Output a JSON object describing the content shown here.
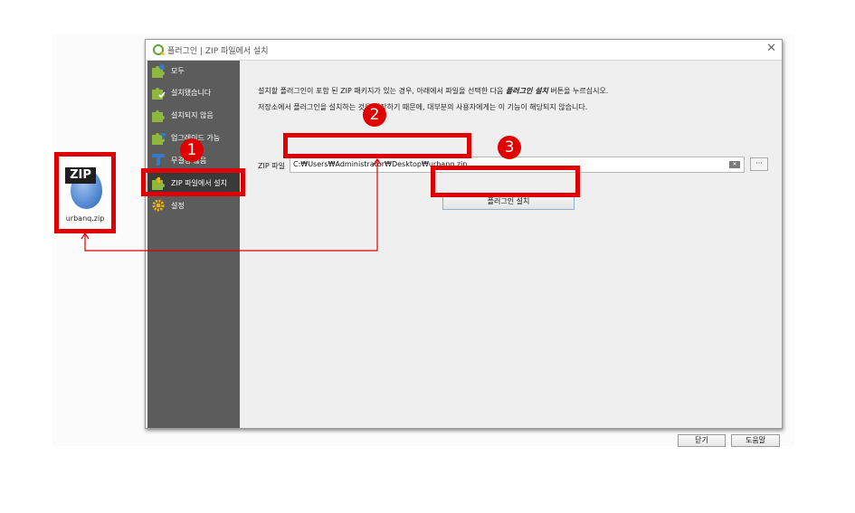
{
  "desktop_file": {
    "name": "urbanq.zip",
    "tag": "ZIP"
  },
  "window": {
    "title": "플러그인 | ZIP 파일에서 설치",
    "close_glyph": "✕"
  },
  "sidebar": {
    "items": [
      {
        "label": "모두",
        "icon": "puzzle-icon"
      },
      {
        "label": "설치됐습니다",
        "icon": "puzzle-installed-icon"
      },
      {
        "label": "설치되지 않음",
        "icon": "puzzle-not-installed-icon"
      },
      {
        "label": "업그레이드 가능",
        "icon": "puzzle-upgradeable-icon"
      },
      {
        "label": "무결성 않음",
        "icon": "puzzle-invalid-icon"
      },
      {
        "label": "ZIP 파일에서 설치",
        "icon": "puzzle-zip-icon"
      },
      {
        "label": "설정",
        "icon": "gear-icon"
      }
    ],
    "selected_index": 5
  },
  "main": {
    "desc_line1_pre": "설치할 플러그인이 포함 된 ZIP 패키지가 있는 경우, 아래에서 파일을 선택한 다음 ",
    "desc_line1_em": "플러그인 설치",
    "desc_line1_post": " 버튼을 누르십시오.",
    "desc_line2": "저장소에서 플러그인을 설치하는 것을 권장하기 때문에, 대부분의 사용자에게는 이 기능이 해당되지 않습니다.",
    "zip_label": "ZIP 파일",
    "zip_path": "C:₩Users₩Administrator₩Desktop₩urbanq.zip",
    "clear_glyph": "✕",
    "browse_label": "···",
    "install_button": "플러그인 설치"
  },
  "footer": {
    "close_button": "닫기",
    "help_button": "도움말"
  },
  "callouts": {
    "one": "1",
    "two": "2",
    "three": "3"
  },
  "colors": {
    "callout": "#e00000",
    "sidebar_bg": "#5c5c5c",
    "dialog_bg": "#efefef"
  }
}
